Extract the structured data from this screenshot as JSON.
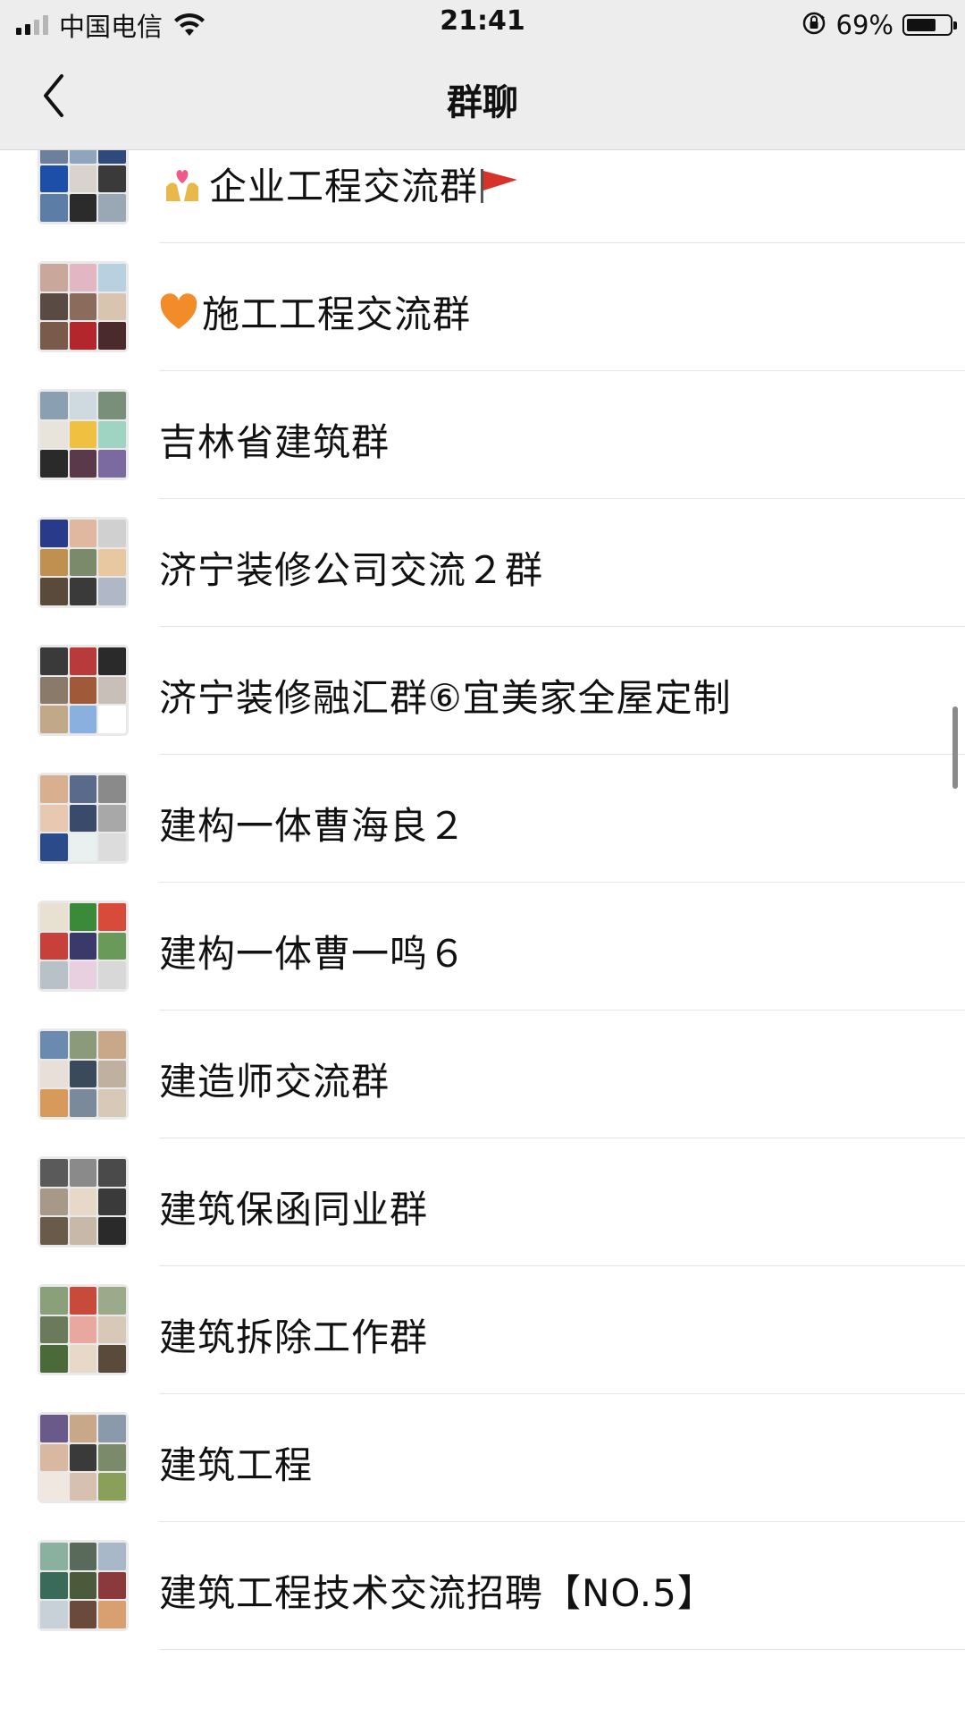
{
  "status": {
    "carrier": "中国电信",
    "time": "21:41",
    "battery_percent": "69%",
    "battery_level": 0.69,
    "signal_bars": 2
  },
  "nav": {
    "title": "群聊",
    "back_icon": "chevron-left-icon"
  },
  "groups": [
    {
      "label": "",
      "icons_before": [],
      "icons_after": []
    },
    {
      "label": "企业工程交流群",
      "icons_before": [
        "heart-couple-icon"
      ],
      "icons_after": [
        "red-flag-icon"
      ]
    },
    {
      "label": "施工工程交流群",
      "icons_before": [
        "orange-heart-icon"
      ],
      "icons_after": []
    },
    {
      "label": "吉林省建筑群",
      "icons_before": [],
      "icons_after": []
    },
    {
      "label": "济宁装修公司交流２群",
      "icons_before": [],
      "icons_after": []
    },
    {
      "label": "济宁装修融汇群⑥宜美家全屋定制",
      "icons_before": [],
      "icons_after": []
    },
    {
      "label": "建构一体曹海良２",
      "icons_before": [],
      "icons_after": []
    },
    {
      "label": "建构一体曹一鸣６",
      "icons_before": [],
      "icons_after": []
    },
    {
      "label": "建造师交流群",
      "icons_before": [],
      "icons_after": []
    },
    {
      "label": "建筑保函同业群",
      "icons_before": [],
      "icons_after": []
    },
    {
      "label": "建筑拆除工作群",
      "icons_before": [],
      "icons_after": []
    },
    {
      "label": "建筑工程",
      "icons_before": [],
      "icons_after": []
    },
    {
      "label": "建筑工程技术交流招聘【NO.5】",
      "icons_before": [],
      "icons_after": []
    }
  ],
  "colors": {
    "topbar_bg": "#ededed",
    "separator": "#e5e5e5",
    "text": "#111111"
  }
}
